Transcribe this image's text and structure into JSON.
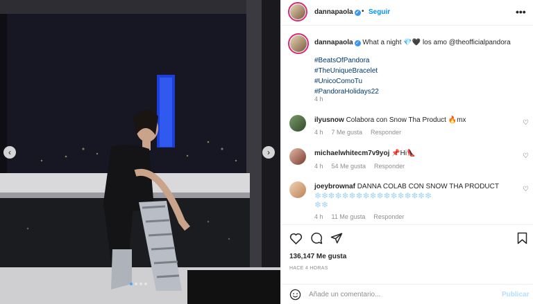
{
  "post": {
    "username": "dannapaola",
    "follow_label": "Seguir",
    "separator": "•",
    "more_label": "•••"
  },
  "caption": {
    "username": "dannapaola",
    "text": "What a night 💎🖤 los amo @theofficialpandora",
    "hashtags": [
      "#BeatsOfPandora",
      "#TheUniqueBracelet",
      "#UnicoComoTu",
      "#PandoraHolidays22"
    ],
    "time": "4 h"
  },
  "comments": [
    {
      "username": "ilyusnow",
      "text": "Colabora con Snow Tha Product 🔥mx",
      "time": "4 h",
      "likes": "7 Me gusta",
      "reply": "Responder"
    },
    {
      "username": "michaelwhitecm7v9yoj",
      "text": "📌Hi👠",
      "time": "4 h",
      "likes": "54 Me gusta",
      "reply": "Responder"
    },
    {
      "username": "joeybrownaf",
      "text": "DANNA COLAB CON SNOW THA PRODUCT",
      "text2": "❄️❄️❄️❄️❄️❄️❄️❄️❄️❄️❄️❄️❄️❄️❄️❄️❄️",
      "text3": "❄️❄️",
      "time": "4 h",
      "likes": "11 Me gusta",
      "reply": "Responder"
    }
  ],
  "stats": {
    "likes": "136,147 Me gusta",
    "ago": "HACE 4 HORAS"
  },
  "add_comment": {
    "placeholder": "Añade un comentario...",
    "publish_label": "Publicar"
  },
  "carousel": {
    "prev": "‹",
    "next": "›",
    "slides": 4,
    "active_slide": 1
  },
  "colors": {
    "link": "#0095f6",
    "hashtag": "#00376b",
    "muted": "#8e8e8e",
    "publish_disabled": "#b2dffc",
    "verified": "#3897f0"
  },
  "icons": [
    "verified-icon",
    "more-icon",
    "heart-icon",
    "comment-icon",
    "share-icon",
    "save-icon",
    "emoji-icon",
    "chevron-left-icon",
    "chevron-right-icon"
  ]
}
